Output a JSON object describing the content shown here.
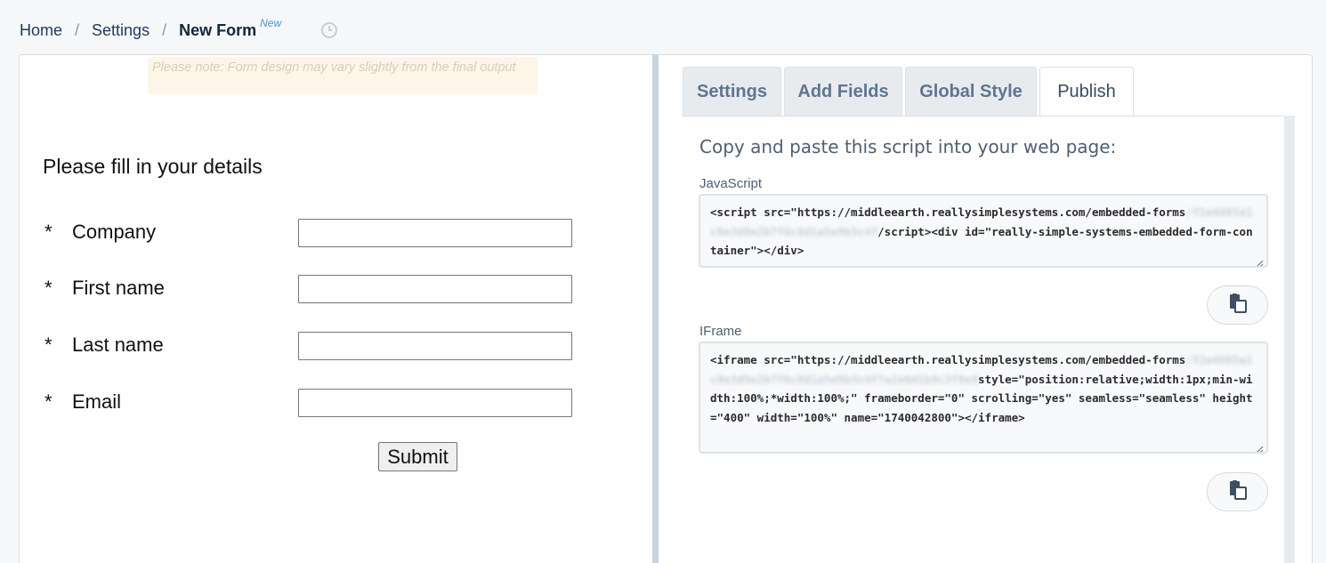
{
  "breadcrumb": {
    "home": "Home",
    "settings": "Settings",
    "current": "New Form",
    "badge": "New",
    "separator": "/"
  },
  "preview": {
    "note": "Please note: Form design may vary slightly from the final output",
    "title": "Please fill in your details",
    "required_marker": "*",
    "fields": [
      {
        "label": "Company",
        "value": ""
      },
      {
        "label": "First name",
        "value": ""
      },
      {
        "label": "Last name",
        "value": ""
      },
      {
        "label": "Email",
        "value": ""
      }
    ],
    "submit_label": "Submit"
  },
  "tabs": [
    {
      "label": "Settings",
      "active": false
    },
    {
      "label": "Add Fields",
      "active": false
    },
    {
      "label": "Global Style",
      "active": false
    },
    {
      "label": "Publish",
      "active": true
    }
  ],
  "publish": {
    "instruction": "Copy and paste this script into your web page:",
    "javascript_label": "JavaScript",
    "javascript_code_before": "<script src=\"https://middleearth.reallysimplesystems.com/embedded-forms",
    "javascript_code_blurred": "/f2a4085a1c0e3d9e2b7f6c8d1a5e9b3c4f",
    "javascript_code_after": "/script><div id=\"really-simple-systems-embedded-form-container\"></div>",
    "iframe_label": "IFrame",
    "iframe_code_before": "<iframe src=\"https://middleearth.reallysimplesystems.com/embedded-forms",
    "iframe_code_blurred": "/f2a4085a1c0e3d9e2b7f6c8d1a5e9b3c4f7a2e6d1b9c3f0e8",
    "iframe_code_after": "style=\"position:relative;width:1px;min-width:100%;*width:100%;\" frameborder=\"0\" scrolling=\"yes\" seamless=\"seamless\" height=\"400\" width=\"100%\" name=\"1740042800\"></iframe>"
  },
  "icons": {
    "history": "history-icon",
    "copy": "clipboard-icon"
  },
  "colors": {
    "accent": "#3a9ad9",
    "tab_text": "#5e7592",
    "note_bg": "#fdf6e8"
  }
}
